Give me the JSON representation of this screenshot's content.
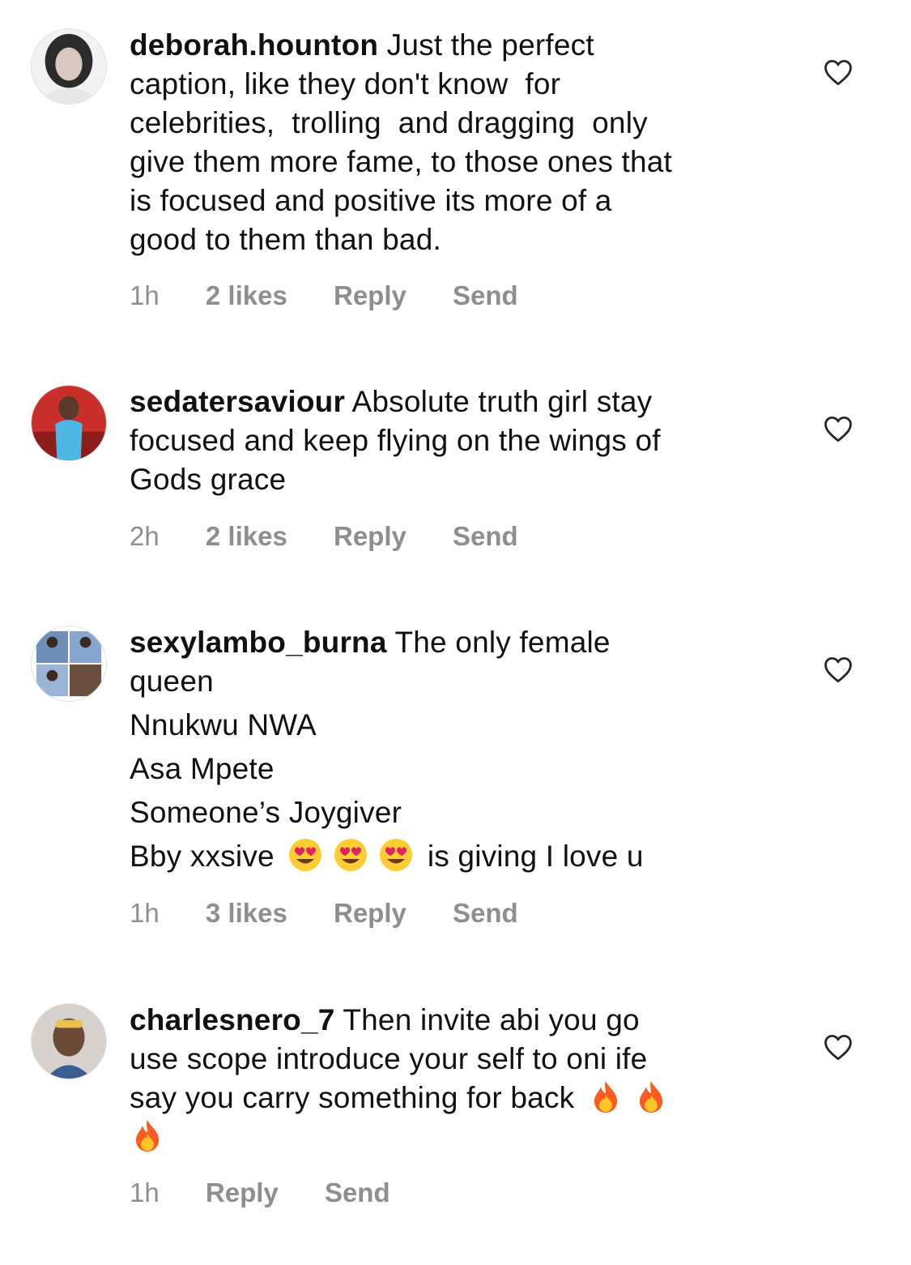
{
  "comments": [
    {
      "username": "deborah.hounton",
      "lines": [
        " Just the perfect",
        "caption, like they don't know  for",
        "celebrities,  trolling  and dragging  only",
        "give them more fame, to those ones that",
        "is focused and positive its more of a",
        "good to them than bad."
      ],
      "time": "1h",
      "likes": "2 likes",
      "reply": "Reply",
      "send": "Send"
    },
    {
      "username": "sedatersaviour",
      "lines": [
        " Absolute truth girl stay",
        "focused and keep flying on the wings of",
        "Gods grace"
      ],
      "time": "2h",
      "likes": "2 likes",
      "reply": "Reply",
      "send": "Send"
    },
    {
      "username": "sexylambo_burna",
      "lines": [
        " The only female",
        "queen",
        "Nnukwu NWA",
        "Asa Mpete",
        "Someone’s Joygiver",
        "Bby xxsive",
        "is giving I love u"
      ],
      "emoji": "heart-eyes-emoji",
      "time": "1h",
      "likes": "3 likes",
      "reply": "Reply",
      "send": "Send"
    },
    {
      "username": "charlesnero_7",
      "lines": [
        " Then invite abi you go",
        "use scope introduce your self to oni ife",
        "say you carry something for back"
      ],
      "emoji": "fire-emoji",
      "time": "1h",
      "reply": "Reply",
      "send": "Send"
    }
  ],
  "colors": {
    "text": "#111111",
    "meta": "#8e8e8e",
    "heart_outline": "#262626"
  },
  "icons": {
    "like": "heart-outline-icon"
  }
}
